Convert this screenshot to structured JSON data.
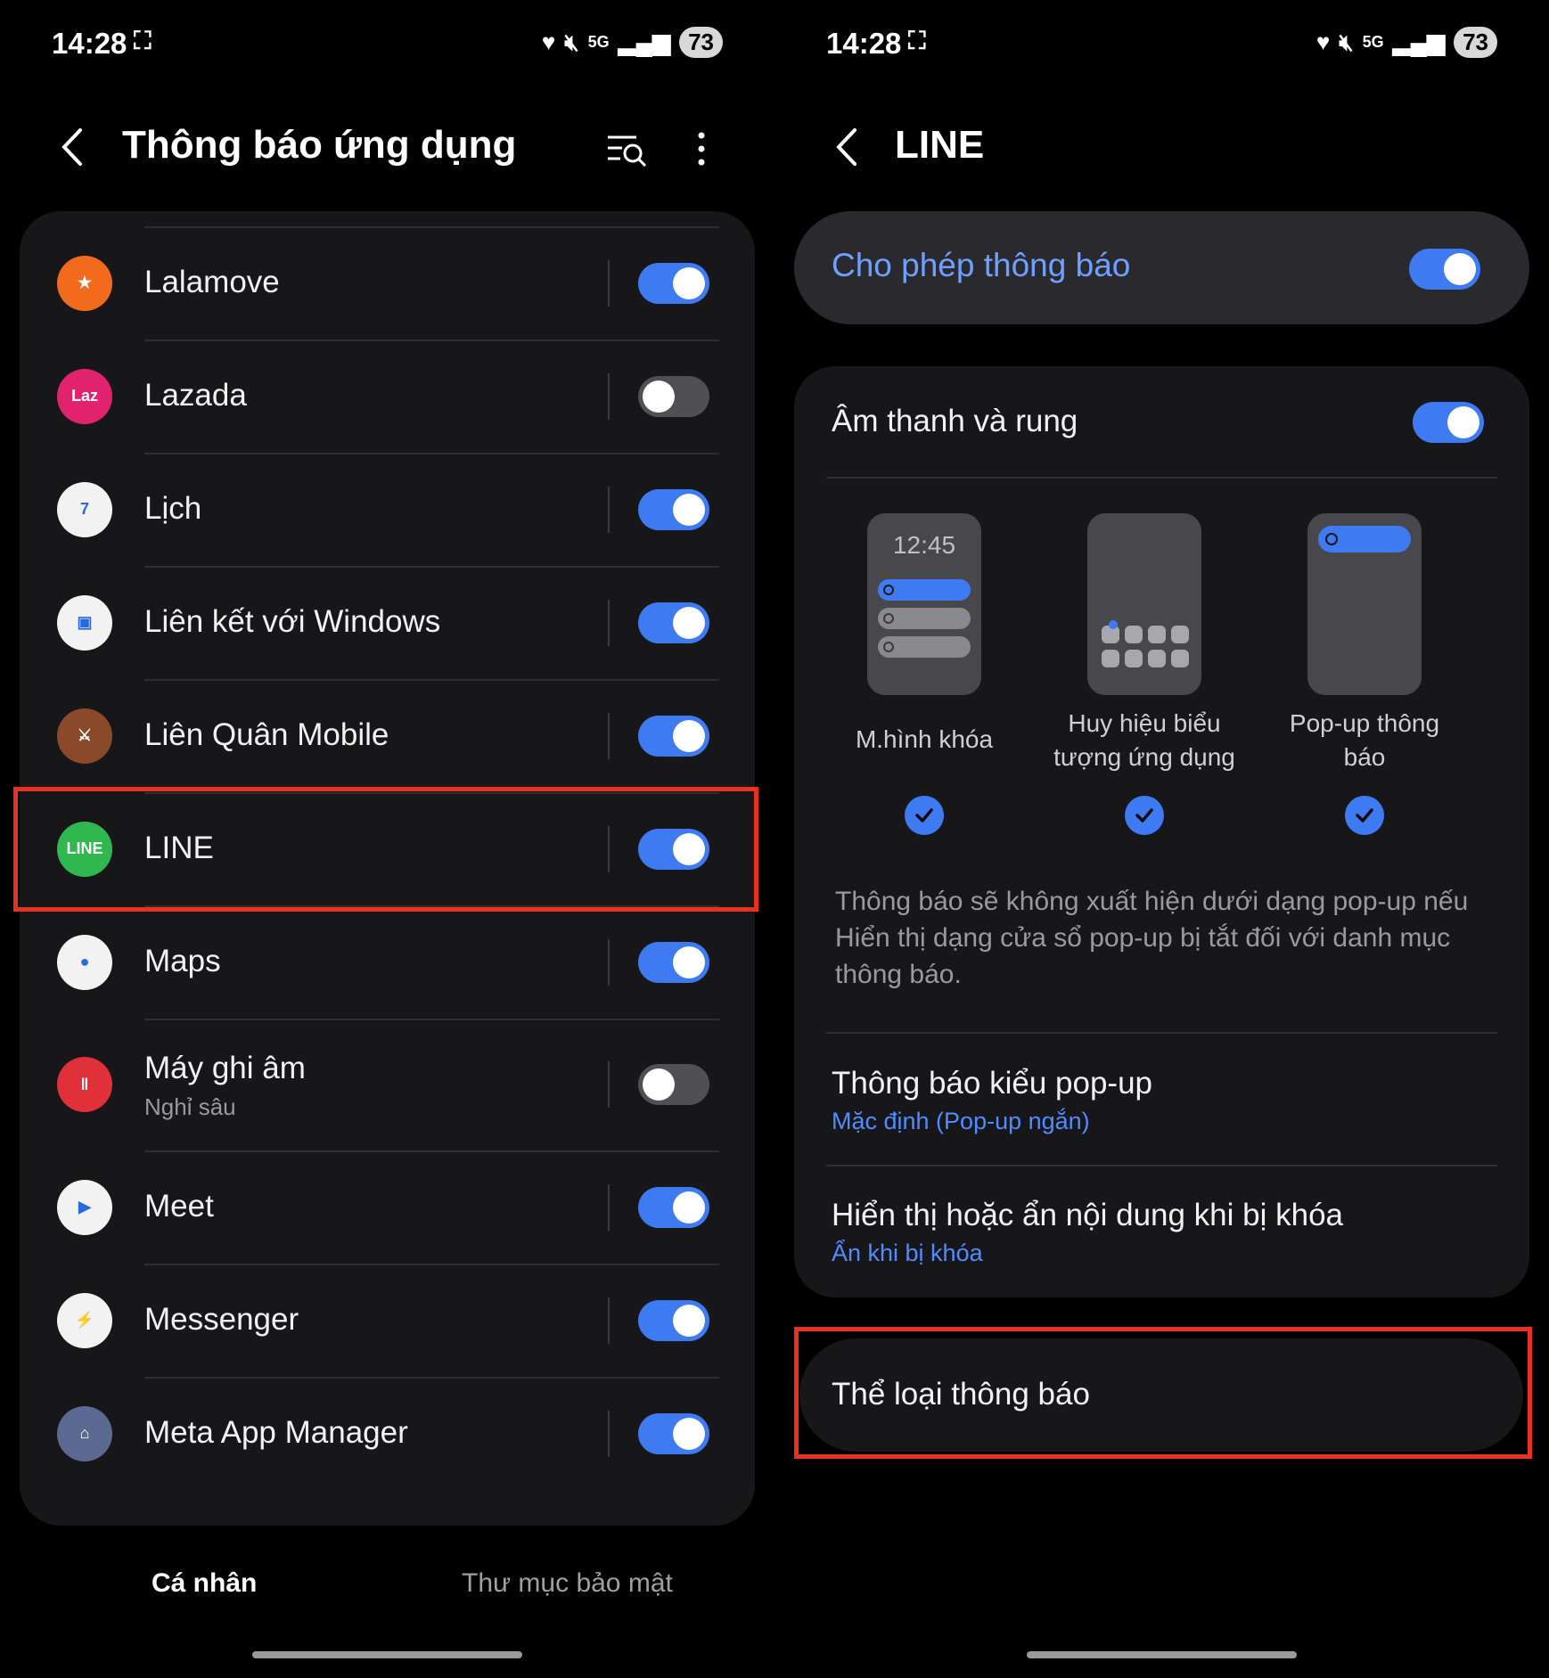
{
  "status": {
    "time": "14:28",
    "battery": "73",
    "network": "5G"
  },
  "left": {
    "title": "Thông báo ứng dụng",
    "apps": [
      {
        "name": "Lalamove",
        "sub": "",
        "on": true,
        "icon": "lalamove-icon",
        "color": "#f26b1d",
        "glyph": "★"
      },
      {
        "name": "Lazada",
        "sub": "",
        "on": false,
        "icon": "lazada-icon",
        "color": "#e0226f",
        "glyph": "Laz"
      },
      {
        "name": "Lịch",
        "sub": "",
        "on": true,
        "icon": "calendar-icon",
        "color": "#f2f2f2",
        "glyph": "7"
      },
      {
        "name": "Liên kết với Windows",
        "sub": "",
        "on": true,
        "icon": "link-to-windows-icon",
        "color": "#f2f2f2",
        "glyph": "▣"
      },
      {
        "name": "Liên Quân Mobile",
        "sub": "",
        "on": true,
        "icon": "lien-quan-icon",
        "color": "#8a4a2a",
        "glyph": "⚔"
      },
      {
        "name": "LINE",
        "sub": "",
        "on": true,
        "icon": "line-icon",
        "color": "#2fb84f",
        "glyph": "LINE"
      },
      {
        "name": "Maps",
        "sub": "",
        "on": true,
        "icon": "maps-icon",
        "color": "#f2f2f2",
        "glyph": "●"
      },
      {
        "name": "Máy ghi âm",
        "sub": "Nghỉ sâu",
        "on": false,
        "icon": "voice-recorder-icon",
        "color": "#e0303a",
        "glyph": "‖"
      },
      {
        "name": "Meet",
        "sub": "",
        "on": true,
        "icon": "meet-icon",
        "color": "#f2f2f2",
        "glyph": "▶"
      },
      {
        "name": "Messenger",
        "sub": "",
        "on": true,
        "icon": "messenger-icon",
        "color": "#f2f2f2",
        "glyph": "⚡"
      },
      {
        "name": "Meta App Manager",
        "sub": "",
        "on": true,
        "icon": "meta-app-manager-icon",
        "color": "#5a6a90",
        "glyph": "⌂"
      }
    ],
    "tabs": {
      "active": "Cá nhân",
      "inactive": "Thư mục bảo mật"
    }
  },
  "right": {
    "title": "LINE",
    "allow_label": "Cho phép thông báo",
    "sound_label": "Âm thanh và rung",
    "phone_clock": "12:45",
    "styles": [
      "M.hình khóa",
      "Huy hiệu biểu tượng ứng dụng",
      "Pop-up thông báo"
    ],
    "note": "Thông báo sẽ không xuất hiện dưới dạng pop-up nếu Hiển thị dạng cửa sổ pop-up bị tắt đối với danh mục thông báo.",
    "popup_style_title": "Thông báo kiểu pop-up",
    "popup_style_value": "Mặc định (Pop-up ngắn)",
    "lock_title": "Hiển thị hoặc ẩn nội dung khi bị khóa",
    "lock_value": "Ẩn khi bị khóa",
    "categories": "Thể loại thông báo"
  },
  "colors": {
    "accent": "#3e7af1",
    "highlight": "#e8321f",
    "link": "#4f8cff"
  }
}
